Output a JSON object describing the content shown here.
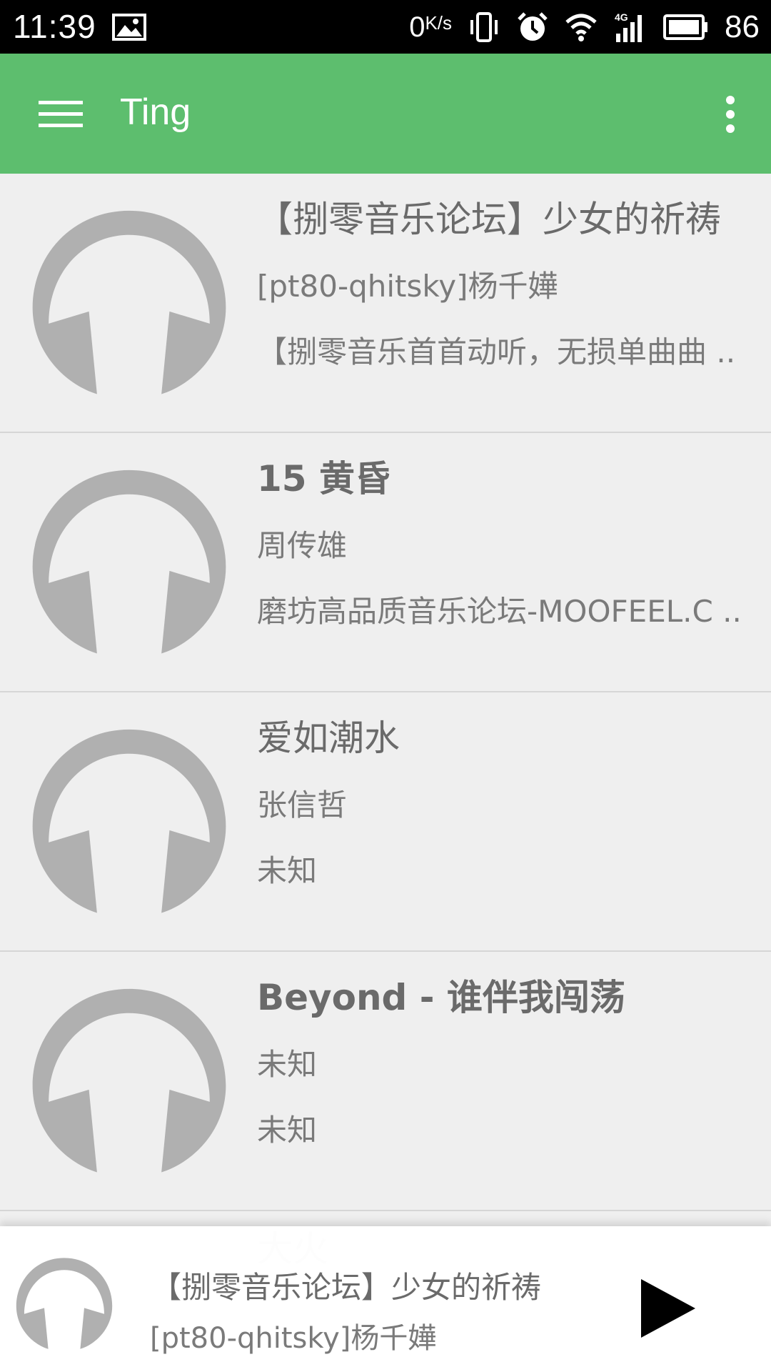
{
  "status_bar": {
    "time": "11:39",
    "net_speed": "0",
    "net_unit": "K/s",
    "battery": "86",
    "icons": [
      "image-icon",
      "vibrate-icon",
      "alarm-icon",
      "wifi-icon",
      "signal-4g-icon",
      "battery-icon"
    ]
  },
  "app_bar": {
    "title": "Ting",
    "menu_icon": "hamburger-menu-icon",
    "overflow_icon": "more-vertical-icon",
    "color": "#5dbe6e"
  },
  "songs": [
    {
      "title": "【捌零音乐论坛】少女的祈祷",
      "artist": "[pt80-qhitsky]杨千嬅",
      "album": "【捌零音乐首首动听，无损单曲曲 ..",
      "bold": false
    },
    {
      "title": "15 黄昏",
      "artist": "周传雄",
      "album": "磨坊高品质音乐论坛-MOOFEEL.C ..",
      "bold": true
    },
    {
      "title": "爱如潮水",
      "artist": "张信哲",
      "album": "未知",
      "bold": false
    },
    {
      "title": "Beyond - 谁伴我闯荡",
      "artist": "未知",
      "album": "未知",
      "bold": true
    }
  ],
  "partial_song": {
    "title": "大火"
  },
  "now_playing": {
    "title": "【捌零音乐论坛】少女的祈祷",
    "artist": "[pt80-qhitsky]杨千嬅",
    "play_icon": "play-icon"
  },
  "colors": {
    "art_gray": "#b0b0b0",
    "text_gray": "#6a6a6a"
  }
}
